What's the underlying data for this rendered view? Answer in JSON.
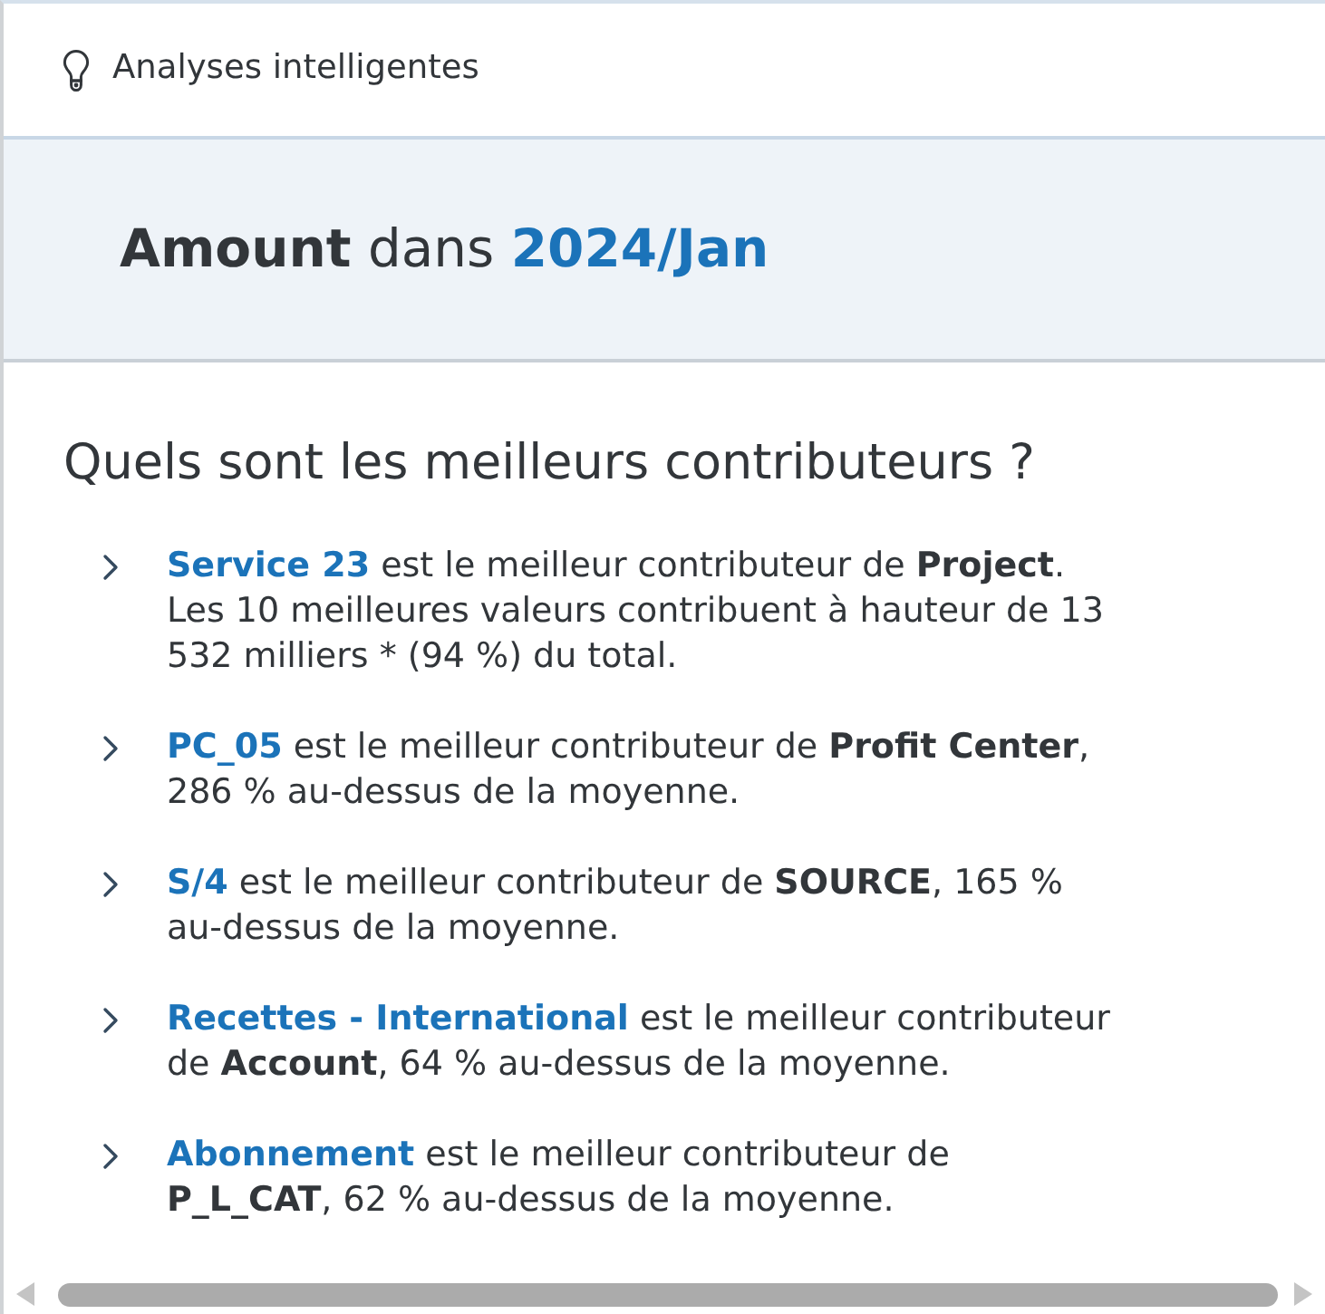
{
  "header": {
    "title": "Analyses intelligentes"
  },
  "banner": {
    "measure": "Amount",
    "connector": "dans",
    "period": "2024/Jan"
  },
  "question": "Quels sont les meilleurs contributeurs ?",
  "insights": [
    {
      "member": "Service 23",
      "text": "est le meilleur contributeur de **Project**. Les 10 meilleures valeurs contribuent à hauteur de 13 532 milliers * (94 %) du total.",
      "expanded": false
    },
    {
      "member": "PC_05",
      "text": "est le meilleur contributeur de **Profit Center**, 286 % au-dessus de la moyenne.",
      "expanded": false
    },
    {
      "member": "S/4",
      "text": "est le meilleur contributeur de **SOURCE**, 165 % au-dessus de la moyenne.",
      "expanded": false
    },
    {
      "member": "Recettes - International",
      "text": "est le meilleur contributeur de **Account**, 64 % au-dessus de la moyenne.",
      "expanded": false
    },
    {
      "member": "Abonnement",
      "text": "est le meilleur contributeur de **P_L_CAT**, 62 % au-dessus de la moyenne.",
      "expanded": false
    }
  ]
}
